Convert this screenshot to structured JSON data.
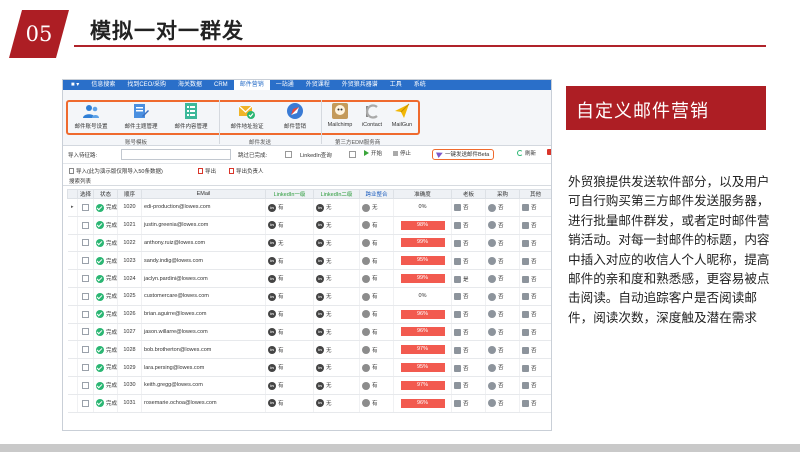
{
  "slide": {
    "number": "05",
    "title": "模拟一对一群发",
    "banner": "自定义邮件营销",
    "description": "外贸狼提供发送软件部分，以及用户可自行购买第三方邮件发送服务器，进行批量邮件群发，或者定时邮件营销活动。对每一封邮件的标题，内容中插入对应的收信人个人昵称，提高邮件的亲和度和熟悉感，更容易被点击阅读。自动追踪客户是否阅读邮件，阅读次数，深度触及潜在需求"
  },
  "app": {
    "menu": [
      "信息搜索",
      "找到CEO/采购",
      "海关数据",
      "CRM",
      "邮件营销",
      "一站通",
      "外贸课程",
      "外贸狼兵器谱",
      "工具",
      "系统"
    ],
    "ribbon": {
      "buttons": [
        "邮件账号设置",
        "邮件主题管理",
        "邮件内容管理",
        "邮件地址验证",
        "邮件营销",
        "Mailchimp",
        "iContact",
        "MailGun"
      ],
      "groups": [
        "账号模板",
        "邮件发送",
        "第三方EDM服务商"
      ]
    },
    "toolbar": {
      "import_path_label": "导入待征路:",
      "skip_label": "跳过已完成:",
      "linkedin_label": "LinkedIn查询",
      "start_label": "开始",
      "stop_label": "停止",
      "send_label": "一键发送邮件Beta",
      "refresh_label": "刷新"
    },
    "actions": {
      "import_label": "导入(此为演示版仅限导入50条数据)",
      "export_label": "导出",
      "export_owner_label": "导出负责人"
    },
    "tab_label": "搜索列表",
    "columns": [
      "选择",
      "状态",
      "顺序",
      "EMail",
      "LinkedIn一级",
      "LinkedIn二级",
      "跨业整合",
      "准确度",
      "老板",
      "采购",
      "其他"
    ],
    "rows": [
      {
        "status": "完成",
        "seq": "1020",
        "email": "edi-production@lowes.com",
        "l1": "有",
        "l2": "无",
        "cross": "无",
        "accuracy": "0%",
        "boss": "否",
        "purchase": "否",
        "other": "否"
      },
      {
        "status": "完成",
        "seq": "1021",
        "email": "justin.greenia@lowes.com",
        "l1": "有",
        "l2": "无",
        "cross": "有",
        "accuracy": "98%",
        "boss": "否",
        "purchase": "否",
        "other": "否"
      },
      {
        "status": "完成",
        "seq": "1022",
        "email": "anthony.ruiz@lowes.com",
        "l1": "无",
        "l2": "无",
        "cross": "有",
        "accuracy": "99%",
        "boss": "否",
        "purchase": "否",
        "other": "否"
      },
      {
        "status": "完成",
        "seq": "1023",
        "email": "sandy.indig@lowes.com",
        "l1": "有",
        "l2": "无",
        "cross": "有",
        "accuracy": "95%",
        "boss": "否",
        "purchase": "否",
        "other": "否"
      },
      {
        "status": "完成",
        "seq": "1024",
        "email": "jaclyn.pardini@lowes.com",
        "l1": "有",
        "l2": "无",
        "cross": "有",
        "accuracy": "99%",
        "boss": "是",
        "purchase": "否",
        "other": "否"
      },
      {
        "status": "完成",
        "seq": "1025",
        "email": "customercare@lowes.com",
        "l1": "有",
        "l2": "无",
        "cross": "有",
        "accuracy": "0%",
        "boss": "否",
        "purchase": "否",
        "other": "否"
      },
      {
        "status": "完成",
        "seq": "1026",
        "email": "brian.aguirre@lowes.com",
        "l1": "有",
        "l2": "无",
        "cross": "有",
        "accuracy": "96%",
        "boss": "否",
        "purchase": "否",
        "other": "否"
      },
      {
        "status": "完成",
        "seq": "1027",
        "email": "jason.willarre@lowes.com",
        "l1": "有",
        "l2": "无",
        "cross": "有",
        "accuracy": "96%",
        "boss": "否",
        "purchase": "否",
        "other": "否"
      },
      {
        "status": "完成",
        "seq": "1028",
        "email": "bob.brotherton@lowes.com",
        "l1": "有",
        "l2": "无",
        "cross": "有",
        "accuracy": "97%",
        "boss": "否",
        "purchase": "否",
        "other": "否"
      },
      {
        "status": "完成",
        "seq": "1029",
        "email": "lara.persing@lowes.com",
        "l1": "有",
        "l2": "无",
        "cross": "有",
        "accuracy": "95%",
        "boss": "否",
        "purchase": "否",
        "other": "否"
      },
      {
        "status": "完成",
        "seq": "1030",
        "email": "keith.gregg@lowes.com",
        "l1": "有",
        "l2": "无",
        "cross": "有",
        "accuracy": "97%",
        "boss": "否",
        "purchase": "否",
        "other": "否"
      },
      {
        "status": "完成",
        "seq": "1031",
        "email": "rosemarie.ochoa@lowes.com",
        "l1": "有",
        "l2": "无",
        "cross": "有",
        "accuracy": "96%",
        "boss": "否",
        "purchase": "否",
        "other": "否"
      }
    ]
  },
  "colors": {
    "accent": "#ad1e24",
    "menubar": "#2a6fc9",
    "highlight": "#ef6a2e",
    "bar": "#f25a4f",
    "ok": "#2bb673"
  }
}
